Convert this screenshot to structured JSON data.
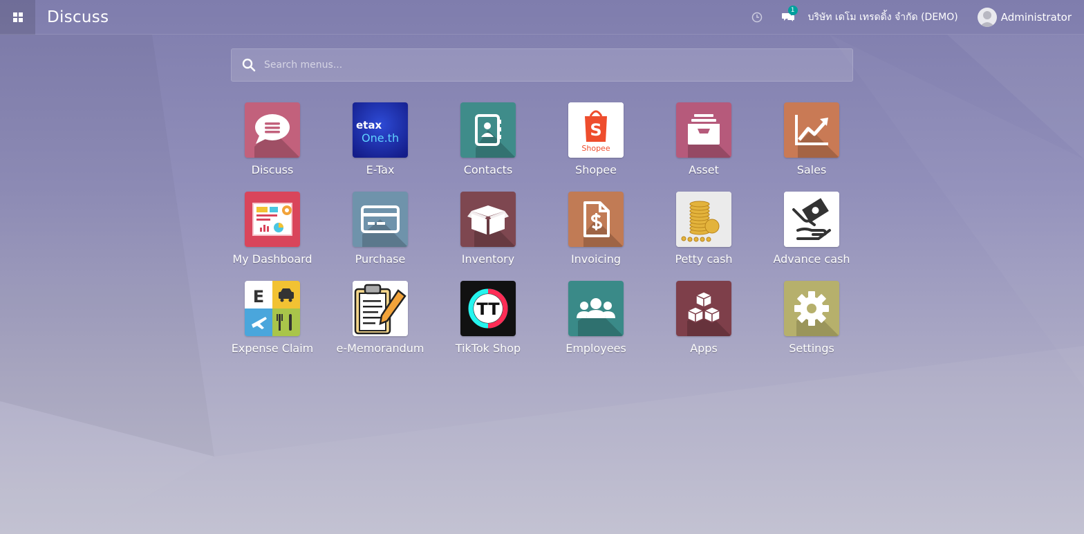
{
  "navbar": {
    "app_title": "Discuss",
    "chat_badge": "1",
    "company": "บริษัท เดโม เทรดดิ้ง จำกัด (DEMO)",
    "user": "Administrator"
  },
  "search": {
    "placeholder": "Search menus..."
  },
  "apps": [
    {
      "label": "Discuss",
      "icon": "chat-bubble-icon",
      "color": "#c2617c"
    },
    {
      "label": "E-Tax",
      "icon": "etax-logo-icon",
      "color": "#1a2a9e",
      "logo_text": [
        "etax",
        "One.th"
      ]
    },
    {
      "label": "Contacts",
      "icon": "address-book-icon",
      "color": "#3f8c8a"
    },
    {
      "label": "Shopee",
      "icon": "shopee-bag-icon",
      "color": "#ee4d2d",
      "logo_text": [
        "S",
        "Shopee"
      ]
    },
    {
      "label": "Asset",
      "icon": "archive-tray-icon",
      "color": "#b65a7b"
    },
    {
      "label": "Sales",
      "icon": "trend-chart-icon",
      "color": "#c97a55"
    },
    {
      "label": "My Dashboard",
      "icon": "dashboard-report-icon",
      "color": "#d9455b"
    },
    {
      "label": "Purchase",
      "icon": "credit-card-icon",
      "color": "#6f93ab"
    },
    {
      "label": "Inventory",
      "icon": "open-box-icon",
      "color": "#7e4750"
    },
    {
      "label": "Invoicing",
      "icon": "invoice-dollar-icon",
      "color": "#c17b55"
    },
    {
      "label": "Petty cash",
      "icon": "coin-stack-icon",
      "color": "#e3b33c"
    },
    {
      "label": "Advance cash",
      "icon": "hand-money-icon",
      "color": "#333333"
    },
    {
      "label": "Expense Claim",
      "icon": "expense-categories-icon",
      "color": "#f2c233",
      "logo_text": [
        "E"
      ]
    },
    {
      "label": "e-Memorandum",
      "icon": "clipboard-pencil-icon",
      "color": "#f2a33a"
    },
    {
      "label": "TikTok Shop",
      "icon": "tiktok-shop-icon",
      "color": "#111111",
      "logo_text": [
        "TT"
      ]
    },
    {
      "label": "Employees",
      "icon": "people-group-icon",
      "color": "#3a8a88"
    },
    {
      "label": "Apps",
      "icon": "cubes-icon",
      "color": "#7e3f4a"
    },
    {
      "label": "Settings",
      "icon": "gear-icon",
      "color": "#b6b06c"
    }
  ]
}
